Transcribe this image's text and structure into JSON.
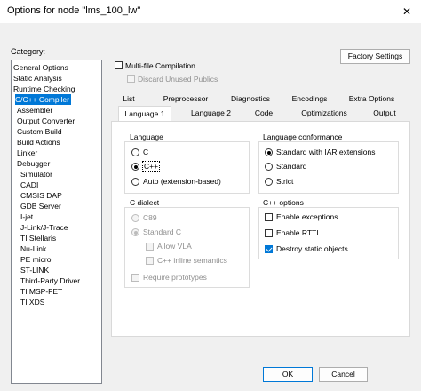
{
  "window": {
    "title": "Options for node \"lms_100_lw\"",
    "close_glyph": "✕"
  },
  "category": {
    "label": "Category:",
    "items": [
      {
        "label": "General Options",
        "indent": 0
      },
      {
        "label": "Static Analysis",
        "indent": 0
      },
      {
        "label": "Runtime Checking",
        "indent": 0
      },
      {
        "label": "C/C++ Compiler",
        "indent": 1,
        "selected": true
      },
      {
        "label": "Assembler",
        "indent": 1
      },
      {
        "label": "Output Converter",
        "indent": 1
      },
      {
        "label": "Custom Build",
        "indent": 1
      },
      {
        "label": "Build Actions",
        "indent": 1
      },
      {
        "label": "Linker",
        "indent": 1
      },
      {
        "label": "Debugger",
        "indent": 1
      },
      {
        "label": "Simulator",
        "indent": 2
      },
      {
        "label": "CADI",
        "indent": 2
      },
      {
        "label": "CMSIS DAP",
        "indent": 2
      },
      {
        "label": "GDB Server",
        "indent": 2
      },
      {
        "label": "I-jet",
        "indent": 2
      },
      {
        "label": "J-Link/J-Trace",
        "indent": 2
      },
      {
        "label": "TI Stellaris",
        "indent": 2
      },
      {
        "label": "Nu-Link",
        "indent": 2
      },
      {
        "label": "PE micro",
        "indent": 2
      },
      {
        "label": "ST-LINK",
        "indent": 2
      },
      {
        "label": "Third-Party Driver",
        "indent": 2
      },
      {
        "label": "TI MSP-FET",
        "indent": 2
      },
      {
        "label": "TI XDS",
        "indent": 2
      }
    ]
  },
  "top": {
    "factory_settings": "Factory Settings",
    "multifile": "Multi-file Compilation",
    "discard_unused": "Discard Unused Publics"
  },
  "tabs_row1": [
    "List",
    "Preprocessor",
    "Diagnostics",
    "Encodings",
    "Extra Options"
  ],
  "tabs_row2": [
    "Language 1",
    "Language 2",
    "Code",
    "Optimizations",
    "Output"
  ],
  "language": {
    "title": "Language",
    "options": [
      "C",
      "C++",
      "Auto (extension-based)"
    ],
    "selected": "C++"
  },
  "conformance": {
    "title": "Language conformance",
    "options": [
      "Standard with IAR extensions",
      "Standard",
      "Strict"
    ],
    "selected": "Standard with IAR extensions"
  },
  "c_dialect": {
    "title": "C dialect",
    "c89": "C89",
    "standard_c": "Standard C",
    "allow_vla": "Allow VLA",
    "cpp_inline": "C++ inline semantics",
    "require_prototypes": "Require prototypes"
  },
  "cpp_options": {
    "title": "C++ options",
    "enable_exceptions": "Enable exceptions",
    "enable_rtti": "Enable RTTI",
    "destroy_static": "Destroy static objects"
  },
  "buttons": {
    "ok": "OK",
    "cancel": "Cancel"
  }
}
